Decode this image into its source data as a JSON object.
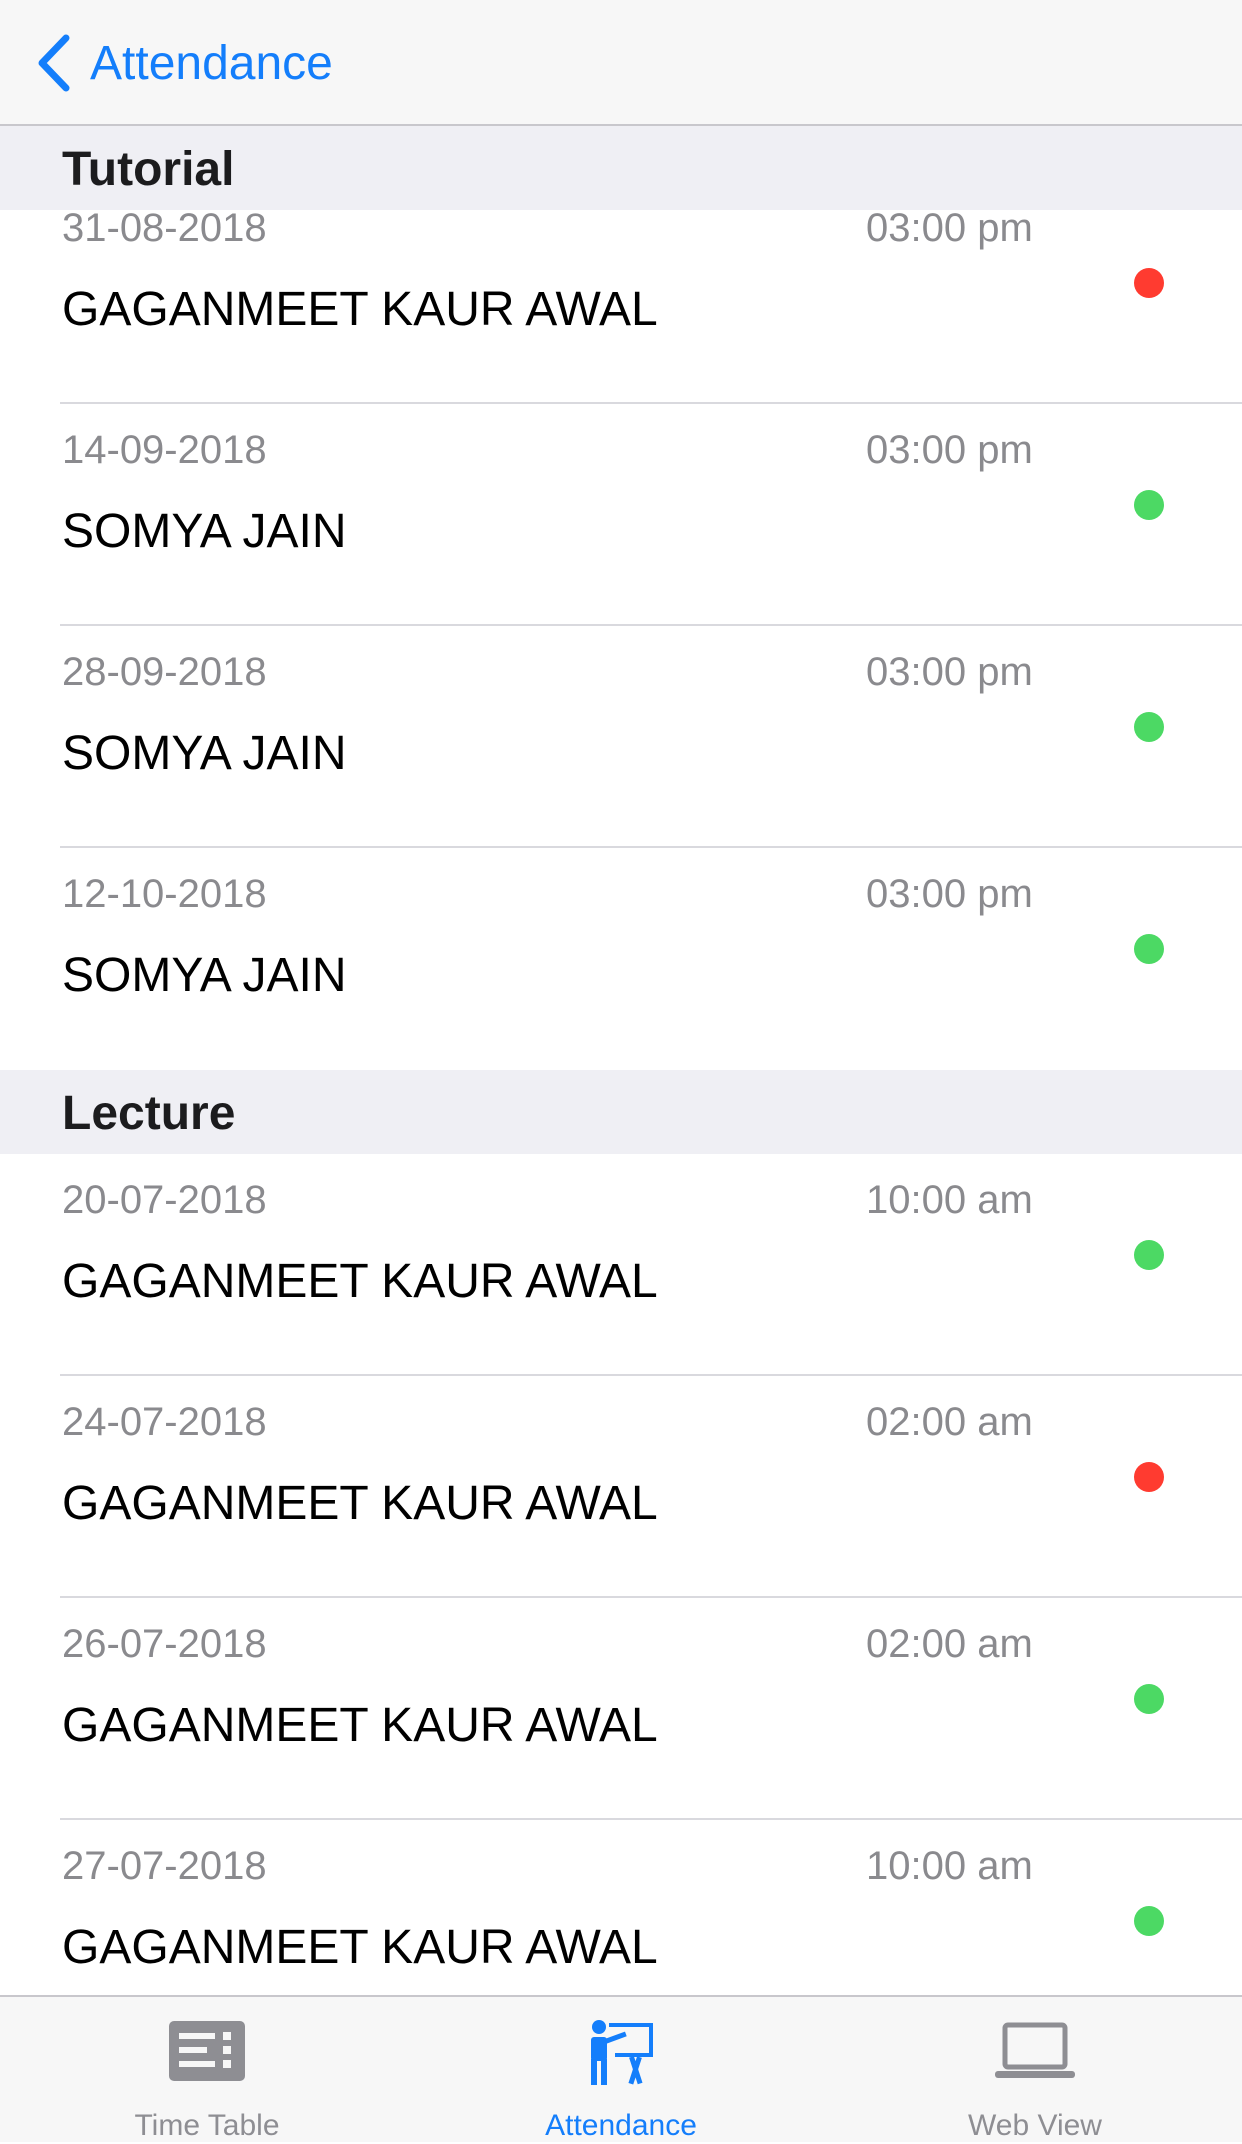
{
  "nav": {
    "back_label": "Attendance"
  },
  "colors": {
    "accent": "#147efb",
    "present": "#4cd964",
    "absent": "#ff3b30"
  },
  "sections": [
    {
      "title": "Tutorial",
      "rows": [
        {
          "date": "31-08-2018",
          "time": "03:00 pm",
          "name": "GAGANMEET KAUR AWAL",
          "status": "absent"
        },
        {
          "date": "14-09-2018",
          "time": "03:00 pm",
          "name": "SOMYA JAIN",
          "status": "present"
        },
        {
          "date": "28-09-2018",
          "time": "03:00 pm",
          "name": "SOMYA JAIN",
          "status": "present"
        },
        {
          "date": "12-10-2018",
          "time": "03:00 pm",
          "name": "SOMYA JAIN",
          "status": "present"
        }
      ]
    },
    {
      "title": "Lecture",
      "rows": [
        {
          "date": "20-07-2018",
          "time": "10:00 am",
          "name": "GAGANMEET KAUR AWAL",
          "status": "present"
        },
        {
          "date": "24-07-2018",
          "time": "02:00 am",
          "name": "GAGANMEET KAUR AWAL",
          "status": "absent"
        },
        {
          "date": "26-07-2018",
          "time": "02:00 am",
          "name": "GAGANMEET KAUR AWAL",
          "status": "present"
        },
        {
          "date": "27-07-2018",
          "time": "10:00 am",
          "name": "GAGANMEET KAUR AWAL",
          "status": "present"
        }
      ]
    }
  ],
  "tabs": [
    {
      "label": "Time Table",
      "icon": "timetable-icon",
      "active": false
    },
    {
      "label": "Attendance",
      "icon": "teacher-board-icon",
      "active": true
    },
    {
      "label": "Web View",
      "icon": "laptop-icon",
      "active": false
    }
  ]
}
